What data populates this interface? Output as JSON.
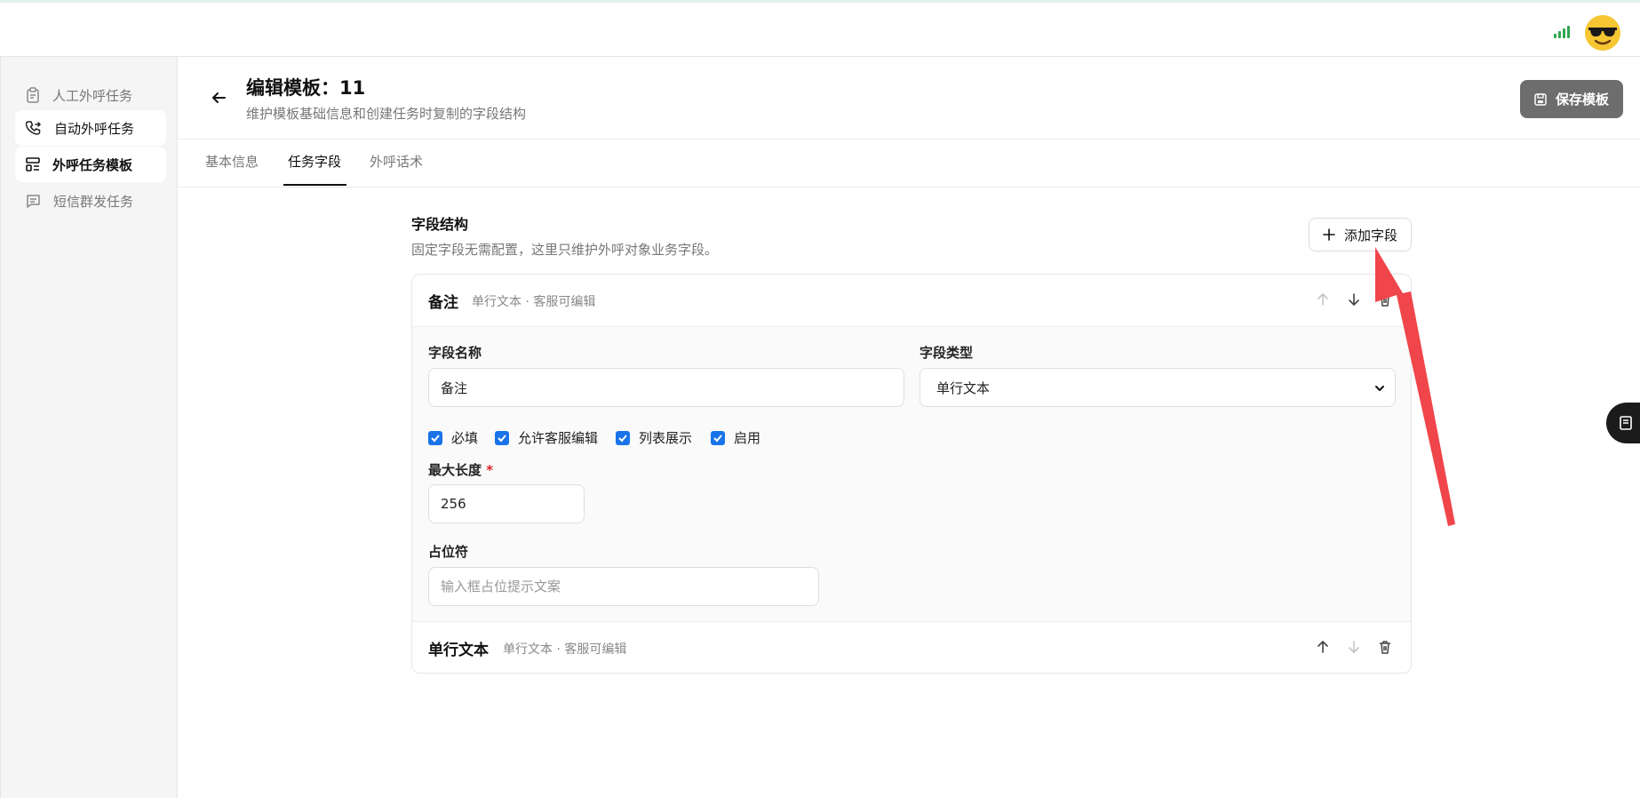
{
  "sidebar": {
    "items": [
      {
        "label": "人工外呼任务",
        "icon": "clipboard-icon"
      },
      {
        "label": "自动外呼任务",
        "icon": "phone-forward-icon"
      },
      {
        "label": "外呼任务模板",
        "icon": "template-icon"
      },
      {
        "label": "短信群发任务",
        "icon": "message-icon"
      }
    ],
    "selected": "外呼任务模板"
  },
  "header": {
    "title": "编辑模板：11",
    "subtitle": "维护模板基础信息和创建任务时复制的字段结构",
    "save_label": "保存模板"
  },
  "tabs": [
    {
      "label": "基本信息"
    },
    {
      "label": "任务字段"
    },
    {
      "label": "外呼话术"
    }
  ],
  "active_tab": "任务字段",
  "section": {
    "title": "字段结构",
    "subtitle": "固定字段无需配置，这里只维护外呼对象业务字段。",
    "add_label": "添加字段"
  },
  "fields": [
    {
      "name": "备注",
      "meta": "单行文本 · 客服可编辑",
      "expanded": true,
      "form": {
        "name_label": "字段名称",
        "name_value": "备注",
        "type_label": "字段类型",
        "type_value": "单行文本",
        "checkboxes": [
          {
            "label": "必填",
            "checked": true
          },
          {
            "label": "允许客服编辑",
            "checked": true
          },
          {
            "label": "列表展示",
            "checked": true
          },
          {
            "label": "启用",
            "checked": true
          }
        ],
        "max_length_label": "最大长度",
        "required_mark": "*",
        "max_length_value": "256",
        "placeholder_label": "占位符",
        "placeholder_hint": "输入框占位提示文案"
      }
    },
    {
      "name": "单行文本",
      "meta": "单行文本 · 客服可编辑",
      "expanded": false
    }
  ],
  "colors": {
    "accent": "#1a73e8",
    "annotation": "#f0454a",
    "save_button": "#6d6d6d",
    "signal": "#2fa84f"
  }
}
